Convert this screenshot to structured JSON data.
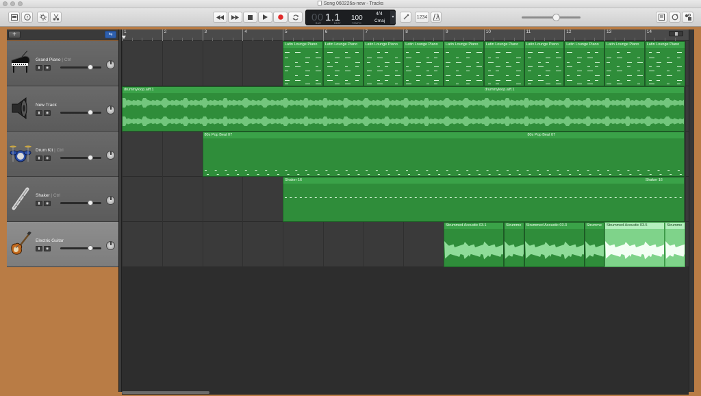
{
  "window": {
    "title": "Song 060226a-new - Tracks"
  },
  "toolbar": {
    "left_icons": [
      "library-icon",
      "help-icon",
      "smart-controls-icon",
      "editors-icon"
    ],
    "transport": [
      "rewind-icon",
      "forward-icon",
      "stop-icon",
      "play-icon",
      "record-icon",
      "cycle-icon"
    ],
    "right_icons": [
      "tuner-icon",
      "count-in-icon",
      "metronome-icon",
      "notepad-icon",
      "loop-browser-icon",
      "media-browser-icon"
    ],
    "count_in_label": "1234",
    "volume_level": 0.58
  },
  "lcd": {
    "bar_prefix": "00",
    "position": "1.1",
    "tempo": "100",
    "time_signature": "4/4",
    "key": "Cmaj",
    "caption_bar": "BAR",
    "caption_beat": "BEAT",
    "caption_tempo": "TEMPO"
  },
  "tracks_header": {
    "add_label": "+",
    "smart_label": "⇆"
  },
  "tracks": [
    {
      "name": "Grand Piano",
      "ctrl": "Ctrl",
      "icon": "grand-piano-icon",
      "selected": false
    },
    {
      "name": "New Track",
      "ctrl": "",
      "icon": "speaker-icon",
      "selected": false
    },
    {
      "name": "Drum Kit",
      "ctrl": "Ctrl",
      "icon": "drum-kit-icon",
      "selected": false
    },
    {
      "name": "Shaker",
      "ctrl": "Ctrl",
      "icon": "shaker-icon",
      "selected": false
    },
    {
      "name": "Electric Guitar",
      "ctrl": "",
      "icon": "electric-guitar-icon",
      "selected": true
    }
  ],
  "ruler": {
    "bars": [
      "1",
      "2",
      "3",
      "4",
      "5",
      "6",
      "7",
      "8",
      "9",
      "10",
      "11",
      "12",
      "13",
      "14"
    ]
  },
  "regions": {
    "piano": [
      "Latin Lounge Piano",
      "Latin Lounge Piano",
      "Latin Lounge Piano",
      "Latin Lounge Piano",
      "Latin Lounge Piano",
      "Latin Lounge Piano",
      "Latin Lounge Piano",
      "Latin Lounge Piano",
      "Latin Lounge Piano",
      "Latin Lounge Piano"
    ],
    "drummy": [
      "drummyloop.aiff.1",
      "drummyloop.aiff.1"
    ],
    "beat": [
      "80s Pop Beat 07",
      "80s Pop Beat 07"
    ],
    "shaker": [
      "Shaker 16",
      "Shaker 16"
    ],
    "guitar": [
      "Strummed Acoustic 03.1",
      "Strumme",
      "Strummed Acoustic 03.3",
      "Strumme",
      "Strummed Acoustic 03.5",
      "Strumme"
    ]
  }
}
